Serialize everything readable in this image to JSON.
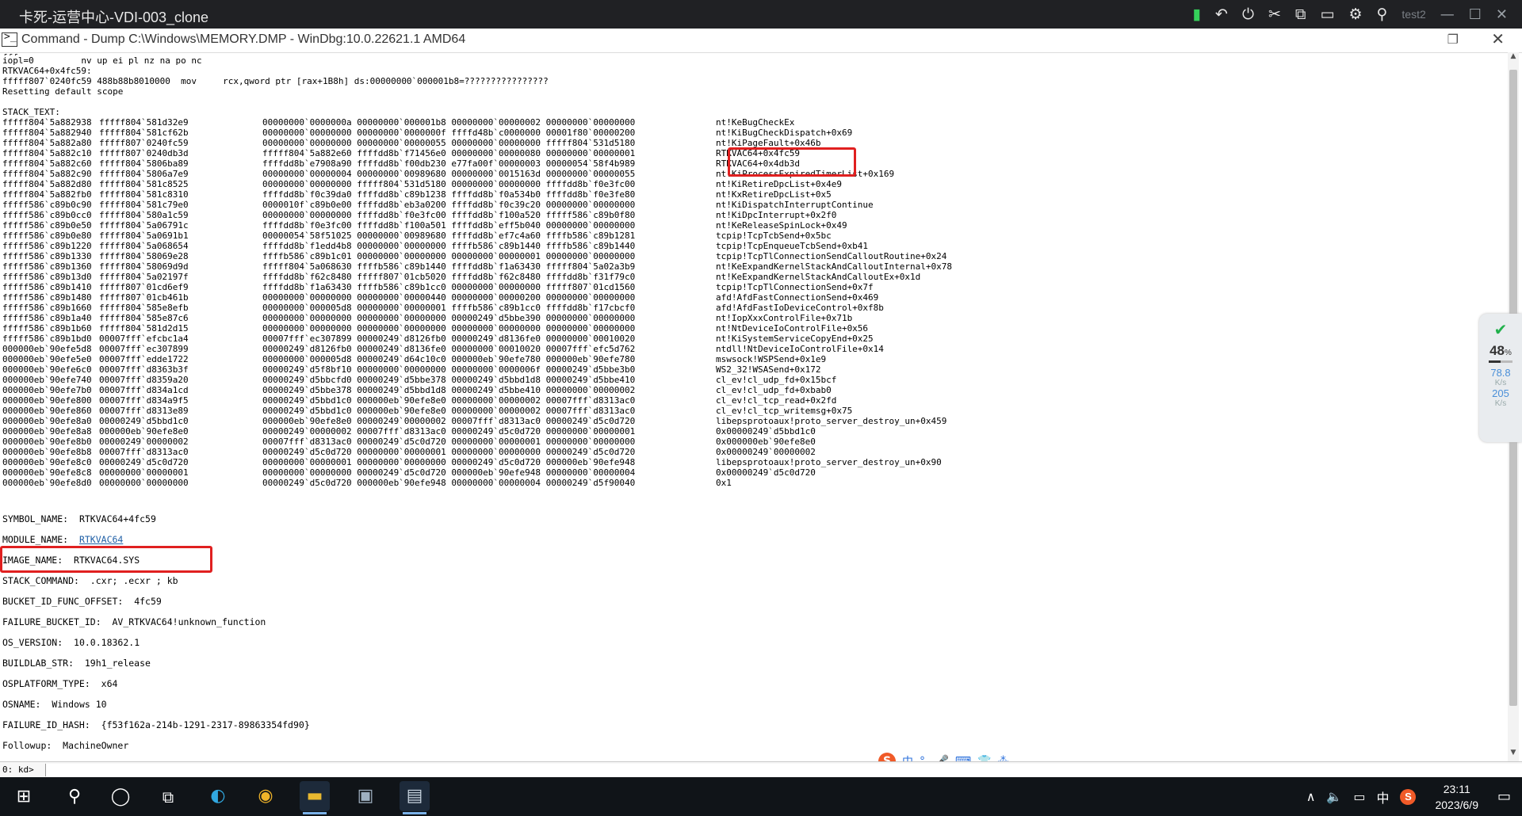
{
  "vdi": {
    "title": "卡死-运营中心-VDI-003_clone",
    "user": "test2",
    "icons": [
      "signal-icon",
      "undo-icon",
      "power-icon",
      "no-network-icon",
      "switch-window-icon",
      "fullscreen-icon",
      "settings-icon",
      "user-settings-icon"
    ],
    "tool_glyphs": [
      "▮",
      "↶",
      "⏻",
      "✂",
      "⧉",
      "▭",
      "⚙",
      "⚲"
    ],
    "win_min": "—",
    "win_max": "☐",
    "win_close": "✕"
  },
  "window": {
    "title": "Command - Dump C:\\Windows\\MEMORY.DMP - WinDbg:10.0.22621.1 AMD64",
    "restore_glyph": "❐",
    "close_glyph": "✕"
  },
  "output": {
    "pre_lines": [
      "iopl=0         nv up ei pl nz na po nc",
      "RTKVAC64+0x4fc59:",
      "fffff807`0240fc59 488b88b8010000  mov     rcx,qword ptr [rax+1B8h] ds:00000000`000001b8=????????????????",
      "Resetting default scope",
      "",
      "STACK_TEXT:"
    ],
    "stack": [
      [
        "fffff804`5a882938",
        "fffff804`581d32e9",
        "00000000`0000000a 00000000`000001b8 00000000`00000002 00000000`00000000",
        "nt!KeBugCheckEx"
      ],
      [
        "fffff804`5a882940",
        "fffff804`581cf62b",
        "00000000`00000000 00000000`0000000f ffffd48b`c0000000 00001f80`00000200",
        "nt!KiBugCheckDispatch+0x69"
      ],
      [
        "fffff804`5a882a80",
        "fffff807`0240fc59",
        "00000000`00000000 00000000`00000055 00000000`00000000 fffff804`531d5180",
        "nt!KiPageFault+0x46b"
      ],
      [
        "fffff804`5a882c10",
        "fffff807`0240db3d",
        "fffff804`5a882e60 ffffdd8b`f71456e0 00000000`00000080 00000000`00000001",
        "RTKVAC64+0x4fc59"
      ],
      [
        "fffff804`5a882c60",
        "fffff804`5806ba89",
        "ffffdd8b`e7908a90 ffffdd8b`f00db230 e77fa00f`00000003 00000054`58f4b989",
        "RTKVAC64+0x4db3d"
      ],
      [
        "fffff804`5a882c90",
        "fffff804`5806a7e9",
        "00000000`00000004 00000000`00989680 00000000`0015163d 00000000`00000055",
        "nt!KiProcessExpiredTimerList+0x169"
      ],
      [
        "fffff804`5a882d80",
        "fffff804`581c8525",
        "00000000`00000000 fffff804`531d5180 00000000`00000000 ffffdd8b`f0e3fc00",
        "nt!KiRetireDpcList+0x4e9"
      ],
      [
        "fffff804`5a882fb0",
        "fffff804`581c8310",
        "ffffdd8b`f0c39da0 ffffdd8b`c89b1238 ffffdd8b`f0a534b0 ffffdd8b`f0e3fe80",
        "nt!KxRetireDpcList+0x5"
      ],
      [
        "fffff586`c89b0c90",
        "fffff804`581c79e0",
        "0000010f`c89b0e00 ffffdd8b`eb3a0200 ffffdd8b`f0c39c20 00000000`00000000",
        "nt!KiDispatchInterruptContinue"
      ],
      [
        "fffff586`c89b0cc0",
        "fffff804`580a1c59",
        "00000000`00000000 ffffdd8b`f0e3fc00 ffffdd8b`f100a520 fffff586`c89b0f80",
        "nt!KiDpcInterrupt+0x2f0"
      ],
      [
        "fffff586`c89b0e50",
        "fffff804`5a06791c",
        "ffffdd8b`f0e3fc00 ffffdd8b`f100a501 ffffdd8b`eff5b040 00000000`00000000",
        "nt!KeReleaseSpinLock+0x49"
      ],
      [
        "fffff586`c89b0e80",
        "fffff804`5a0691b1",
        "00000054`58f51025 00000000`00989680 ffffdd8b`ef7c4a60 ffffb586`c89b1281",
        "tcpip!TcpTcbSend+0x5bc"
      ],
      [
        "fffff586`c89b1220",
        "fffff804`5a068654",
        "ffffdd8b`f1edd4b8 00000000`00000000 ffffb586`c89b1440 ffffb586`c89b1440",
        "tcpip!TcpEnqueueTcbSend+0xb41"
      ],
      [
        "fffff586`c89b1330",
        "fffff804`58069e28",
        "ffffb586`c89b1c01 00000000`00000000 00000000`00000001 00000000`00000000",
        "tcpip!TcpTlConnectionSendCalloutRoutine+0x24"
      ],
      [
        "fffff586`c89b1360",
        "fffff804`58069d9d",
        "fffff804`5a068630 ffffb586`c89b1440 ffffdd8b`f1a63430 fffff804`5a02a3b9",
        "nt!KeExpandKernelStackAndCalloutInternal+0x78"
      ],
      [
        "fffff586`c89b13d0",
        "fffff804`5a02197f",
        "ffffdd8b`f62c8480 fffff807`01cb5020 ffffdd8b`f62c8480 ffffdd8b`f31f79c0",
        "nt!KeExpandKernelStackAndCalloutEx+0x1d"
      ],
      [
        "fffff586`c89b1410",
        "fffff807`01cd6ef9",
        "ffffdd8b`f1a63430 ffffb586`c89b1cc0 00000000`00000000 fffff807`01cd1560",
        "tcpip!TcpTlConnectionSend+0x7f"
      ],
      [
        "fffff586`c89b1480",
        "fffff807`01cb461b",
        "00000000`00000000 00000000`00000440 00000000`00000200 00000000`00000000",
        "afd!AfdFastConnectionSend+0x469"
      ],
      [
        "fffff586`c89b1660",
        "fffff804`585e8efb",
        "00000000`000005d8 00000000`00000001 ffffb586`c89b1cc0 ffffdd8b`f17cbcf0",
        "afd!AfdFastIoDeviceControl+0xf8b"
      ],
      [
        "fffff586`c89b1a40",
        "fffff804`585e87c6",
        "00000000`00000000 00000000`00000000 00000249`d5bbe390 00000000`00000000",
        "nt!IopXxxControlFile+0x71b"
      ],
      [
        "fffff586`c89b1b60",
        "fffff804`581d2d15",
        "00000000`00000000 00000000`00000000 00000000`00000000 00000000`00000000",
        "nt!NtDeviceIoControlFile+0x56"
      ],
      [
        "fffff586`c89b1bd0",
        "00007fff`efcbc1a4",
        "00007fff`ec307899 00000249`d8126fb0 00000249`d8136fe0 00000000`00010020",
        "nt!KiSystemServiceCopyEnd+0x25"
      ],
      [
        "000000eb`90efe5d8",
        "00007fff`ec307899",
        "00000249`d8126fb0 00000249`d8136fe0 00000000`00010020 00007fff`efc5d762",
        "ntdll!NtDeviceIoControlFile+0x14"
      ],
      [
        "000000eb`90efe5e0",
        "00007fff`edde1722",
        "00000000`000005d8 00000249`d64c10c0 000000eb`90efe780 000000eb`90efe780",
        "mswsock!WSPSend+0x1e9"
      ],
      [
        "000000eb`90efe6c0",
        "00007fff`d8363b3f",
        "00000249`d5f8bf10 00000000`00000000 00000000`0000006f 00000249`d5bbe3b0",
        "WS2_32!WSASend+0x172"
      ],
      [
        "000000eb`90efe740",
        "00007fff`d8359a20",
        "00000249`d5bbcfd0 00000249`d5bbe378 00000249`d5bbd1d8 00000249`d5bbe410",
        "cl_ev!cl_udp_fd+0x15bcf"
      ],
      [
        "000000eb`90efe7b0",
        "00007fff`d834a1cd",
        "00000249`d5bbe378 00000249`d5bbd1d8 00000249`d5bbe410 00000000`00000002",
        "cl_ev!cl_udp_fd+0xbab0"
      ],
      [
        "000000eb`90efe800",
        "00007fff`d834a9f5",
        "00000249`d5bbd1c0 000000eb`90efe8e0 00000000`00000002 00007fff`d8313ac0",
        "cl_ev!cl_tcp_read+0x2fd"
      ],
      [
        "000000eb`90efe860",
        "00007fff`d8313e89",
        "00000249`d5bbd1c0 000000eb`90efe8e0 00000000`00000002 00007fff`d8313ac0",
        "cl_ev!cl_tcp_writemsg+0x75"
      ],
      [
        "000000eb`90efe8a0",
        "00000249`d5bbd1c0",
        "000000eb`90efe8e0 00000249`00000002 00007fff`d8313ac0 00000249`d5c0d720",
        "libepsprotoaux!proto_server_destroy_un+0x459"
      ],
      [
        "000000eb`90efe8a8",
        "000000eb`90efe8e0",
        "00000249`00000002 00007fff`d8313ac0 00000249`d5c0d720 00000000`00000001",
        "0x00000249`d5bbd1c0"
      ],
      [
        "000000eb`90efe8b0",
        "00000249`00000002",
        "00007fff`d8313ac0 00000249`d5c0d720 00000000`00000001 00000000`00000000",
        "0x000000eb`90efe8e0"
      ],
      [
        "000000eb`90efe8b8",
        "00007fff`d8313ac0",
        "00000249`d5c0d720 00000000`00000001 00000000`00000000 00000249`d5c0d720",
        "0x00000249`00000002"
      ],
      [
        "000000eb`90efe8c0",
        "00000249`d5c0d720",
        "00000000`00000001 00000000`00000000 00000249`d5c0d720 000000eb`90efe948",
        "libepsprotoaux!proto_server_destroy_un+0x90"
      ],
      [
        "000000eb`90efe8c8",
        "00000000`00000001",
        "00000000`00000000 00000249`d5c0d720 000000eb`90efe948 00000000`00000004",
        "0x00000249`d5c0d720"
      ],
      [
        "000000eb`90efe8d0",
        "00000000`00000000",
        "00000249`d5c0d720 000000eb`90efe948 00000000`00000004 00000249`d5f90040",
        "0x1"
      ]
    ],
    "fields": [
      {
        "label": "SYMBOL_NAME:",
        "value": "RTKVAC64+4fc59"
      },
      {
        "label": "MODULE_NAME:",
        "value": "RTKVAC64",
        "link": true
      },
      {
        "label": "IMAGE_NAME:",
        "value": "RTKVAC64.SYS"
      },
      {
        "label": "STACK_COMMAND:",
        "value": ".cxr; .ecxr ; kb"
      },
      {
        "label": "BUCKET_ID_FUNC_OFFSET:",
        "value": "4fc59"
      },
      {
        "label": "FAILURE_BUCKET_ID:",
        "value": "AV_RTKVAC64!unknown_function"
      },
      {
        "label": "OS_VERSION:",
        "value": "10.0.18362.1"
      },
      {
        "label": "BUILDLAB_STR:",
        "value": "19h1_release"
      },
      {
        "label": "OSPLATFORM_TYPE:",
        "value": "x64"
      },
      {
        "label": "OSNAME:",
        "value": "Windows 10"
      },
      {
        "label": "FAILURE_ID_HASH:",
        "value": "{f53f162a-214b-1291-2317-89863354fd90}"
      },
      {
        "label": "Followup:",
        "value": "MachineOwner"
      }
    ],
    "separator": "---------"
  },
  "prompt": {
    "label": "0: kd>",
    "value": ""
  },
  "widget": {
    "percent": "48",
    "percent_suffix": "%",
    "up": "78.8",
    "up_unit": "K/s",
    "down": "205",
    "down_unit": "K/s",
    "shield_glyph": "✔"
  },
  "ime": {
    "logo": "S",
    "lang": "中",
    "items": [
      "°,",
      "🎤",
      "⌨",
      "👕",
      "⁂"
    ]
  },
  "taskbar": {
    "start_glyph": "⊞",
    "search_glyph": "⚲",
    "cortana_glyph": "◯",
    "taskview_glyph": "⧉",
    "apps": [
      {
        "name": "edge",
        "glyph": "◐"
      },
      {
        "name": "chrome",
        "glyph": "◉"
      },
      {
        "name": "files",
        "glyph": "▬"
      },
      {
        "name": "remote",
        "glyph": "▣"
      },
      {
        "name": "windbg",
        "glyph": "▤"
      }
    ],
    "tray_glyphs": [
      "∧",
      "🔈",
      "▭"
    ],
    "tray_lang": "中",
    "tray_s": "S",
    "time": "23:11",
    "date": "2023/6/9",
    "notify_glyph": "▭"
  },
  "colors": {
    "highlight": "#e02020",
    "link": "#1f5fa6",
    "vdi_bar": "#202124",
    "taskbar": "#101418"
  }
}
